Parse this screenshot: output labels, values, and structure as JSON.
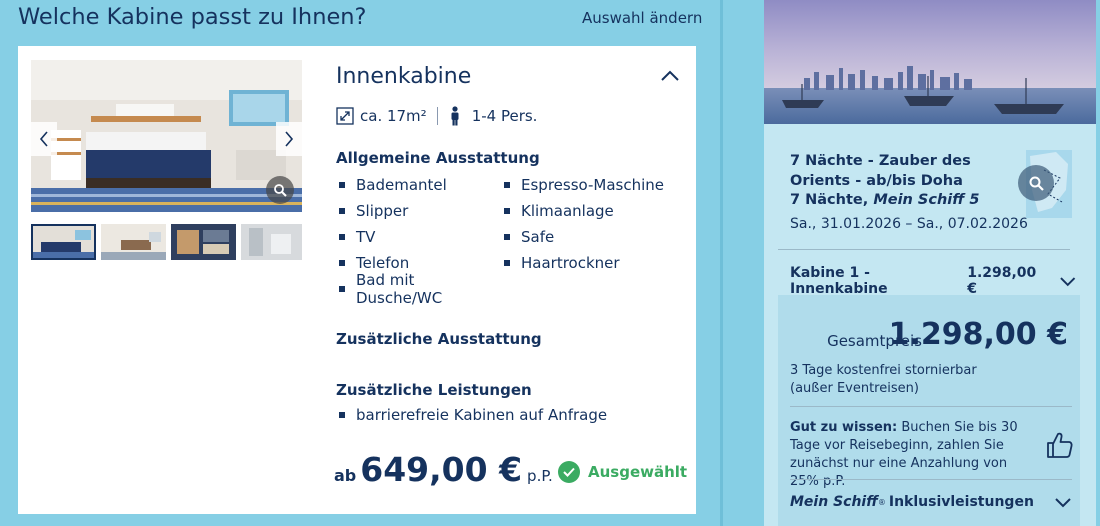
{
  "header": {
    "title": "Welche Kabine passt zu Ihnen?",
    "change_link": "Auswahl ändern"
  },
  "cabin": {
    "name": "Innenkabine",
    "size": "ca. 17m²",
    "persons": "1-4 Pers.",
    "general_title": "Allgemeine Ausstattung",
    "general_items": [
      "Bademantel",
      "Espresso-Maschine",
      "Slipper",
      "Klimaanlage",
      "TV",
      "Safe",
      "Telefon",
      "Haartrockner",
      "Bad mit Dusche/WC"
    ],
    "additional_equipment_title": "Zusätzliche Ausstattung",
    "additional_services_title": "Zusätzliche Leistungen",
    "additional_services": [
      "barrierefreie Kabinen auf Anfrage"
    ],
    "price_prefix": "ab",
    "price": "649,00 €",
    "price_suffix": "p.P.",
    "selected_label": "Ausgewählt",
    "selected_color": "#3bab62"
  },
  "sidebar": {
    "trip_title_line1": "7 Nächte - Zauber des",
    "trip_title_line2": "Orients - ab/bis Doha",
    "trip_title_line3_prefix": "7 Nächte,",
    "trip_ship": "Mein Schiff 5",
    "trip_dates": "Sa., 31.01.2026 – Sa., 07.02.2026",
    "cabin_row_label": "Kabine 1 - Innenkabine",
    "cabin_row_price": "1.298,00 €",
    "total_label": "Gesamtpreis",
    "total_amount": "1.298,00 €",
    "storno_text": "3 Tage kostenfrei stornierbar (außer Eventreisen)",
    "good_to_know_label": "Gut zu wissen:",
    "good_to_know_text": "Buchen Sie bis 30 Tage vor Reisebeginn, zahlen Sie zunächst nur eine Anzahlung von 25% p.P.",
    "inklusiv_brand": "Mein Schiff",
    "inklusiv_sup": "®",
    "inklusiv_text": "Inklusivleistungen"
  },
  "colors": {
    "background": "#86cfe5",
    "primary": "#15325e",
    "sidebar_bg": "#c4e7f2",
    "total_box_bg": "#b0dceb"
  },
  "icons": {
    "gallery_prev": "chevron-left-icon",
    "gallery_next": "chevron-right-icon",
    "zoom": "magnifier-icon",
    "collapse": "chevron-up-icon",
    "size": "resize-arrows-icon",
    "person": "person-icon",
    "selected": "check-circle-icon",
    "expand": "chevron-down-icon",
    "good_to_know": "thumbs-up-icon"
  }
}
